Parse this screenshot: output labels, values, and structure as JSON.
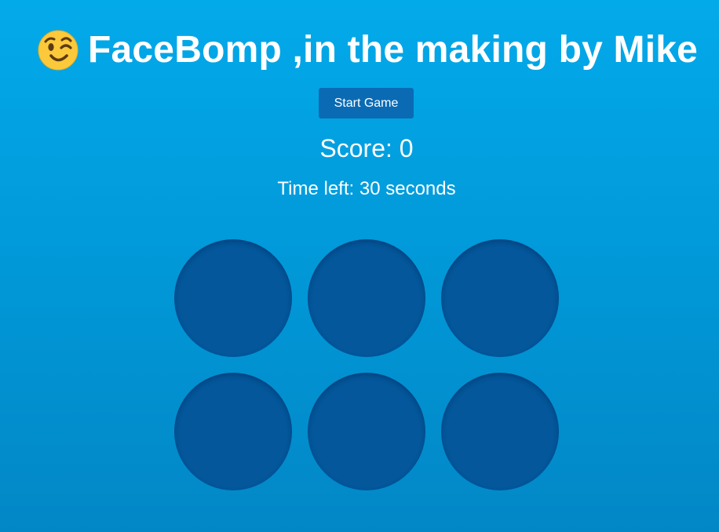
{
  "header": {
    "emoji_icon": "winking-face-icon",
    "title": "FaceBomp ,in the making by Mike"
  },
  "controls": {
    "start_label": "Start Game"
  },
  "status": {
    "score_text": "Score: 0",
    "time_text": "Time left: 30 seconds"
  },
  "board": {
    "holes": [
      "",
      "",
      "",
      "",
      "",
      ""
    ]
  },
  "colors": {
    "background_top": "#03aaea",
    "background_bottom": "#0287c6",
    "button": "#0a6bb4",
    "hole": "#03579a",
    "emoji_face": "#fcc93a"
  }
}
